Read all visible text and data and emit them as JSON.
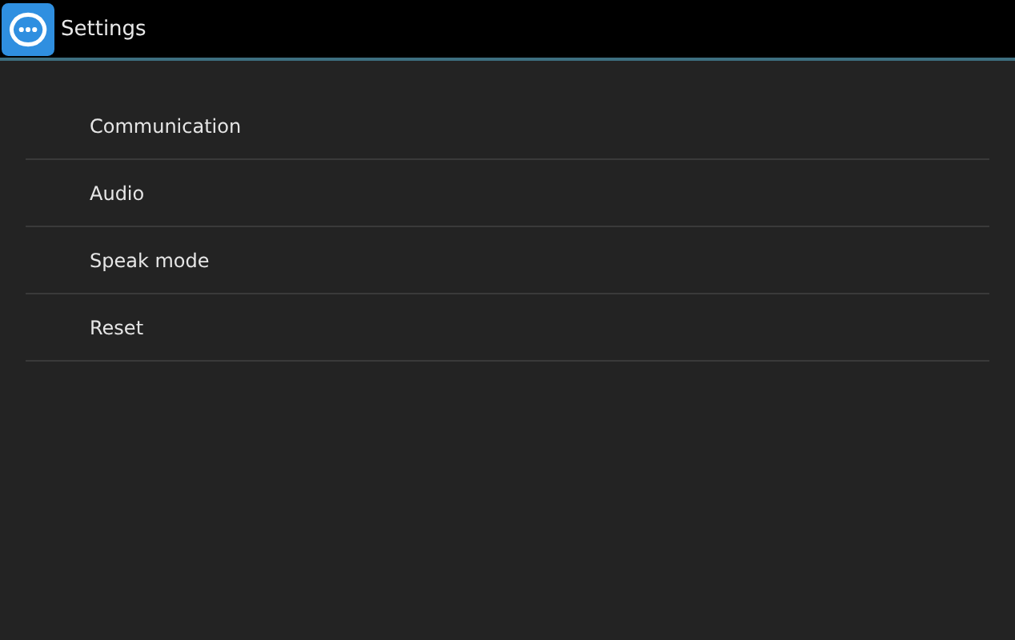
{
  "action_bar": {
    "title": "Settings"
  },
  "items": [
    {
      "label": "Communication"
    },
    {
      "label": "Audio"
    },
    {
      "label": "Speak mode"
    },
    {
      "label": "Reset"
    }
  ]
}
